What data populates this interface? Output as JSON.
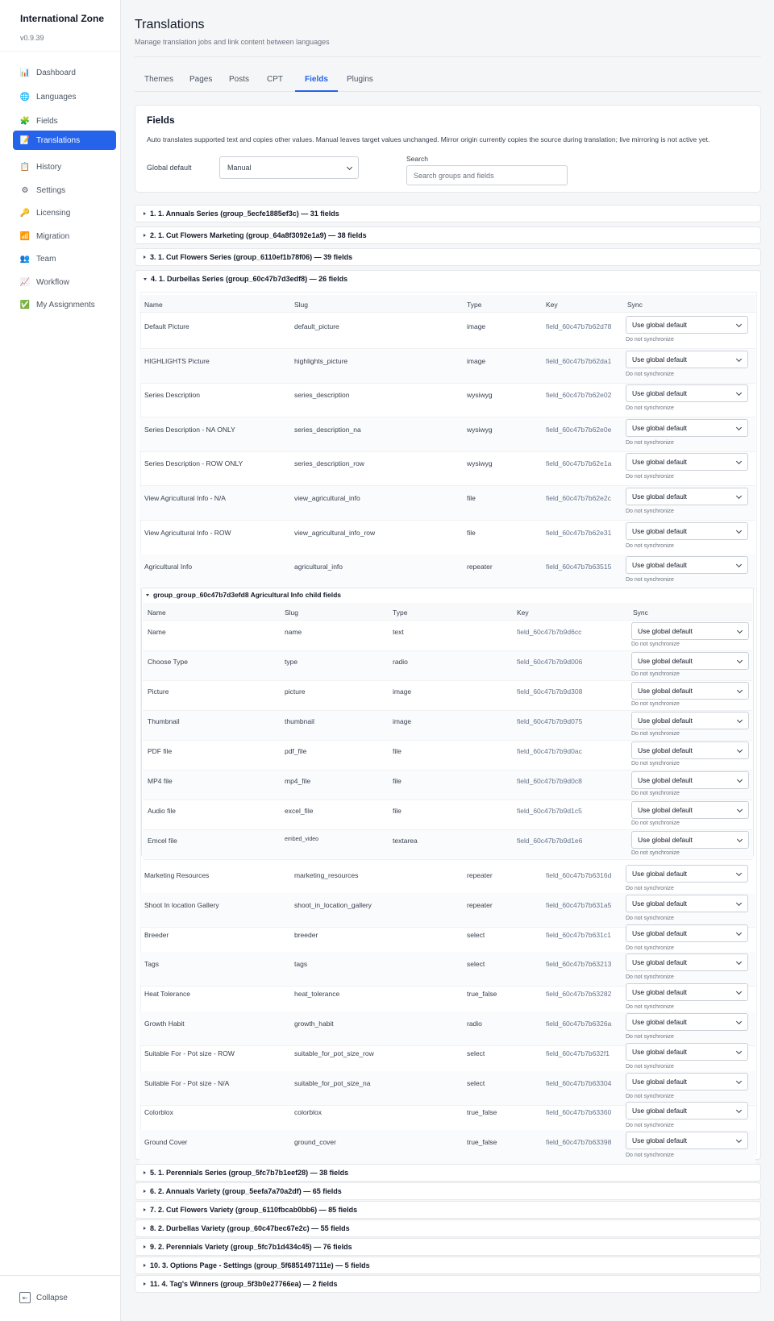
{
  "app": {
    "title": "International Zone",
    "version": "v0.9.39"
  },
  "sidebar": {
    "items": [
      {
        "label": "Dashboard",
        "icon": "chart-icon",
        "glyph": "📊",
        "active": false
      },
      {
        "label": "Languages",
        "icon": "globe-icon",
        "glyph": "🌐",
        "active": false
      },
      {
        "label": "Fields",
        "icon": "puzzle-icon",
        "glyph": "🧩",
        "active": false
      },
      {
        "label": "Translations",
        "icon": "memo-icon",
        "glyph": "📝",
        "active": true
      },
      {
        "label": "History",
        "icon": "clipboard-icon",
        "glyph": "📋",
        "active": false
      },
      {
        "label": "Settings",
        "icon": "gear-icon",
        "glyph": "⚙",
        "active": false
      },
      {
        "label": "Licensing",
        "icon": "key-icon",
        "glyph": "🔑",
        "active": false
      },
      {
        "label": "Migration",
        "icon": "bar-chart-icon",
        "glyph": "📶",
        "active": false
      },
      {
        "label": "Team",
        "icon": "people-icon",
        "glyph": "👥",
        "active": false
      },
      {
        "label": "Workflow",
        "icon": "trend-icon",
        "glyph": "📈",
        "active": false
      },
      {
        "label": "My Assignments",
        "icon": "check-icon",
        "glyph": "✅",
        "active": false
      }
    ],
    "collapse_label": "Collapse"
  },
  "header": {
    "title": "Translations",
    "subtitle": "Manage translation jobs and link content between languages"
  },
  "tabs": [
    {
      "label": "Themes",
      "active": false
    },
    {
      "label": "Pages",
      "active": false
    },
    {
      "label": "Posts",
      "active": false
    },
    {
      "label": "CPT",
      "active": false
    },
    {
      "label": "Fields",
      "active": true
    },
    {
      "label": "Plugins",
      "active": false
    }
  ],
  "fields_card": {
    "title": "Fields",
    "description": "Auto translates supported text and copies other values. Manual leaves target values unchanged. Mirror origin currently copies the source during translation; live mirroring is not active yet.",
    "global_default_label": "Global default",
    "global_default_value": "Manual",
    "search_label": "Search",
    "search_placeholder": "Search groups and fields"
  },
  "groups_before": [
    "1. 1. Annuals Series (group_5ecfe1885ef3c) — 31 fields",
    "2. 1. Cut Flowers Marketing (group_64a8f3092e1a9) — 38 fields",
    "3. 1. Cut Flowers Series (group_6110ef1b78f06) — 39 fields"
  ],
  "open_group": {
    "title": "4. 1. Durbellas Series (group_60c47b7d3edf8) — 26 fields",
    "columns": [
      "Name",
      "Slug",
      "Type",
      "Key",
      "Sync"
    ],
    "sync_value": "Use global default",
    "sync_hint": "Do not synchronize",
    "rows_top": [
      [
        "Default Picture",
        "default_picture",
        "image",
        "field_60c47b7b62d78"
      ],
      [
        "HIGHLIGHTS Picture",
        "highlights_picture",
        "image",
        "field_60c47b7b62da1"
      ],
      [
        "Series Description",
        "series_description",
        "wysiwyg",
        "field_60c47b7b62e02"
      ],
      [
        "Series Description - NA ONLY",
        "series_description_na",
        "wysiwyg",
        "field_60c47b7b62e0e"
      ],
      [
        "Series Description - ROW ONLY",
        "series_description_row",
        "wysiwyg",
        "field_60c47b7b62e1a"
      ],
      [
        "View Agricultural Info - N/A",
        "view_agricultural_info",
        "file",
        "field_60c47b7b62e2c"
      ],
      [
        "View Agricultural Info - ROW",
        "view_agricultural_info_row",
        "file",
        "field_60c47b7b62e31"
      ],
      [
        "Agricultural Info",
        "agricultural_info",
        "repeater",
        "field_60c47b7b63515"
      ]
    ],
    "subgroup": {
      "title": "group_group_60c47b7d3efd8 Agricultural Info child fields",
      "rows": [
        [
          "Name",
          "name",
          "text",
          "field_60c47b7b9d6cc"
        ],
        [
          "Choose Type",
          "type",
          "radio",
          "field_60c47b7b9d006"
        ],
        [
          "Picture",
          "picture",
          "image",
          "field_60c47b7b9d308"
        ],
        [
          "Thumbnail",
          "thumbnail",
          "image",
          "field_60c47b7b9d075"
        ],
        [
          "PDF file",
          "pdf_file",
          "file",
          "field_60c47b7b9d0ac"
        ],
        [
          "MP4 file",
          "mp4_file",
          "file",
          "field_60c47b7b9d0c8"
        ],
        [
          "Audio file",
          "excel_file",
          "file",
          "field_60c47b7b9d1c5"
        ],
        [
          "Emcel file",
          "embed_video",
          "textarea",
          "field_60c47b7b9d1e6"
        ]
      ]
    },
    "rows_bottom": [
      [
        "Marketing Resources",
        "marketing_resources",
        "repeater",
        "field_60c47b7b6316d"
      ],
      [
        "Shoot In location Gallery",
        "shoot_in_location_gallery",
        "repeater",
        "field_60c47b7b631a5"
      ],
      [
        "Breeder",
        "breeder",
        "select",
        "field_60c47b7b631c1"
      ],
      [
        "Tags",
        "tags",
        "select",
        "field_60c47b7b63213"
      ],
      [
        "Heat Tolerance",
        "heat_tolerance",
        "true_false",
        "field_60c47b7b63282"
      ],
      [
        "Growth Habit",
        "growth_habit",
        "radio",
        "field_60c47b7b6326a"
      ],
      [
        "Suitable For - Pot size - ROW",
        "suitable_for_pot_size_row",
        "select",
        "field_60c47b7b632f1"
      ],
      [
        "Suitable For - Pot size - N/A",
        "suitable_for_pot_size_na",
        "select",
        "field_60c47b7b63304"
      ],
      [
        "Colorblox",
        "colorblox",
        "true_false",
        "field_60c47b7b63360"
      ],
      [
        "Ground Cover",
        "ground_cover",
        "true_false",
        "field_60c47b7b63398"
      ]
    ]
  },
  "groups_after": [
    "5. 1. Perennials Series (group_5fc7b7b1eef28) — 38 fields",
    "6. 2. Annuals Variety (group_5eefa7a70a2df) — 65 fields",
    "7. 2. Cut Flowers Variety (group_6110fbcab0bb6) — 85 fields",
    "8. 2. Durbellas Variety (group_60c47bec67e2c) — 55 fields",
    "9. 2. Perennials Variety (group_5fc7b1d434c45) — 76 fields",
    "10. 3. Options Page - Settings (group_5f6851497111e) — 5 fields",
    "11. 4. Tag's Winners (group_5f3b0e27766ea) — 2 fields"
  ]
}
